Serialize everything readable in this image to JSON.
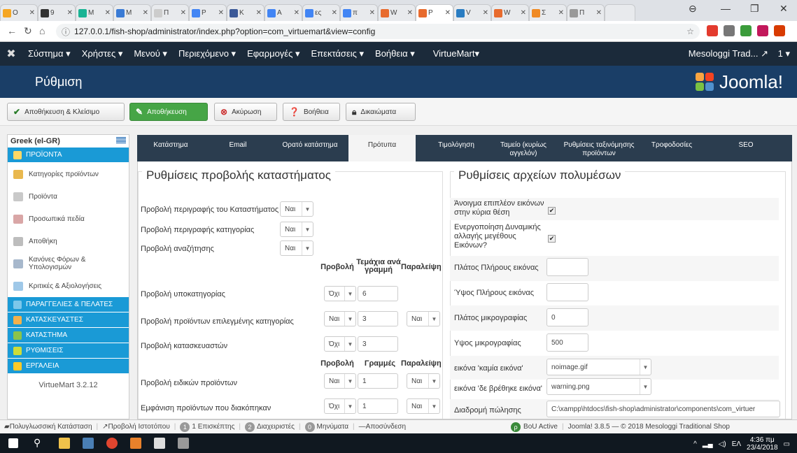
{
  "browser": {
    "tabs": [
      "Ο",
      "9",
      "Μ",
      "Μ",
      "Π",
      "P",
      "K",
      "A",
      "ες",
      "π",
      "W",
      "P",
      "V",
      "W",
      "Σ",
      "Π"
    ],
    "url": "127.0.0.1/fish-shop/administrator/index.php?option=com_virtuemart&view=config"
  },
  "adminbar": {
    "menu": [
      "Σύστημα ▾",
      "Χρήστες ▾",
      "Μενού ▾",
      "Περιεχόμενο ▾",
      "Εφαρμογές ▾",
      "Επεκτάσεις ▾",
      "Βοήθεια ▾",
      "VirtueMart▾"
    ],
    "site_name": "Mesologgi Trad...",
    "user": "1 ▾"
  },
  "header": {
    "title": "Ρύθμιση",
    "brand": "Joomla!"
  },
  "toolbar": {
    "save_close": "Αποθήκευση & Κλείσιμο",
    "save": "Αποθήκευση",
    "cancel": "Ακύρωση",
    "help": "Βοήθεια",
    "permissions": "Δικαιώματα"
  },
  "sidebar": {
    "language": "Greek (el-GR)",
    "sections": {
      "products": "ΠΡΟΪΟΝΤΑ",
      "orders": "ΠΑΡΑΓΓΕΛΙΕΣ & ΠΕΛΑΤΕΣ",
      "manufacturers": "ΚΑΤΑΣΚΕΥΑΣΤΕΣ",
      "store": "ΚΑΤΑΣΤΗΜΑ",
      "settings": "ΡΥΘΜΙΣΕΙΣ",
      "tools": "ΕΡΓΑΛΕΙΑ"
    },
    "items": [
      "Κατηγορίες προϊόντων",
      "Προϊόντα",
      "Προσωπικά πεδία",
      "Αποθήκη",
      "Κανόνες Φόρων & Υπολογισμών",
      "Κριτικές & Αξιολογήσεις"
    ],
    "version": "VirtueMart 3.2.12"
  },
  "tabs": [
    "Κατάστημα",
    "Email",
    "Ορατό κατάστημα",
    "Πρότυπα",
    "Τιμολόγηση",
    "Ταμείο (κυρίως αγγελόν)",
    "Ρυθμίσεις ταξινόμησης προϊόντων",
    "Τροφοδοσίες",
    "SEO"
  ],
  "left_panel": {
    "legend": "Ρυθμίσεις προβολής καταστήματος",
    "rows": {
      "shop_desc": {
        "label": "Προβολή περιγραφής του Καταστήματος",
        "value": "Ναι"
      },
      "cat_desc": {
        "label": "Προβολή περιγραφής κατηγορίας",
        "value": "Ναι"
      },
      "search": {
        "label": "Προβολή αναζήτησης",
        "value": "Ναι"
      }
    },
    "headers1": {
      "show": "Προβολή",
      "per_row": "Τεμάχια ανά γραμμή",
      "omit": "Παραλείψη"
    },
    "subcat": {
      "label": "Προβολή υποκατηγορίας",
      "show": "Όχι",
      "per_row": "6"
    },
    "featured": {
      "label": "Προβολή προϊόντων επιλεγμένης κατηγορίας",
      "show": "Ναι",
      "per_row": "3",
      "omit": "Ναι"
    },
    "manufacturers": {
      "label": "Προβολή κατασκευαστών",
      "show": "Όχι",
      "per_row": "3"
    },
    "headers2": {
      "show": "Προβολή",
      "rows": "Γραμμές",
      "omit": "Παραλείψη"
    },
    "special": {
      "label": "Προβολή ειδικών προϊόντων",
      "show": "Ναι",
      "rows": "1",
      "omit": "Ναι"
    },
    "discontinued": {
      "label": "Εμφάνιση προϊόντων που διακόπηκαν",
      "show": "Όχι",
      "rows": "1",
      "omit": "Ναι"
    }
  },
  "right_panel": {
    "legend": "Ρυθμίσεις αρχείων πολυμέσων",
    "extra_images": {
      "label": "Άνοιγμα επιπλέον εικόνων στην κύρια θέση",
      "checked": "✔"
    },
    "dynamic_resize": {
      "label": "Ενεργοποίηση Δυναμικής αλλαγής μεγέθους Εικόνων?",
      "checked": "✔"
    },
    "full_width": {
      "label": "Πλάτος Πλήρους εικόνας",
      "value": ""
    },
    "full_height": {
      "label": "Ύψος Πλήρους εικόνας",
      "value": ""
    },
    "thumb_width": {
      "label": "Πλάτος μικρογραφίας",
      "value": "0"
    },
    "thumb_height": {
      "label": "Υψος μικρογραφίας",
      "value": "500"
    },
    "no_image": {
      "label": "εικόνα 'καμία εικόνα'",
      "value": "noimage.gif"
    },
    "not_found": {
      "label": "εικόνα 'δε βρέθηκε εικόνα'",
      "value": "warning.png"
    },
    "sale_path": {
      "label": "Διαδρομή πώλησης",
      "value": "C:\\xampp\\htdocs\\fish-shop\\administrator\\components\\com_virtuer"
    }
  },
  "statusbar": {
    "multilang": "Πολυγλωσσική Κατάσταση",
    "preview": "Προβολή Ιστοτόπου",
    "visitors_count": "1",
    "visitors": "1 Επισκέπτης",
    "admins_count": "2",
    "admins": "Διαχειριστές",
    "messages_count": "0",
    "messages": "Μηνύματα",
    "logout": "Αποσύνδεση",
    "bou": "BoU Active",
    "copyright": "Joomla! 3.8.5 — © 2018 Mesologgi Traditional Shop"
  },
  "taskbar": {
    "lang": "ΕΛ",
    "time": "4:36 πμ",
    "date": "23/4/2018"
  }
}
